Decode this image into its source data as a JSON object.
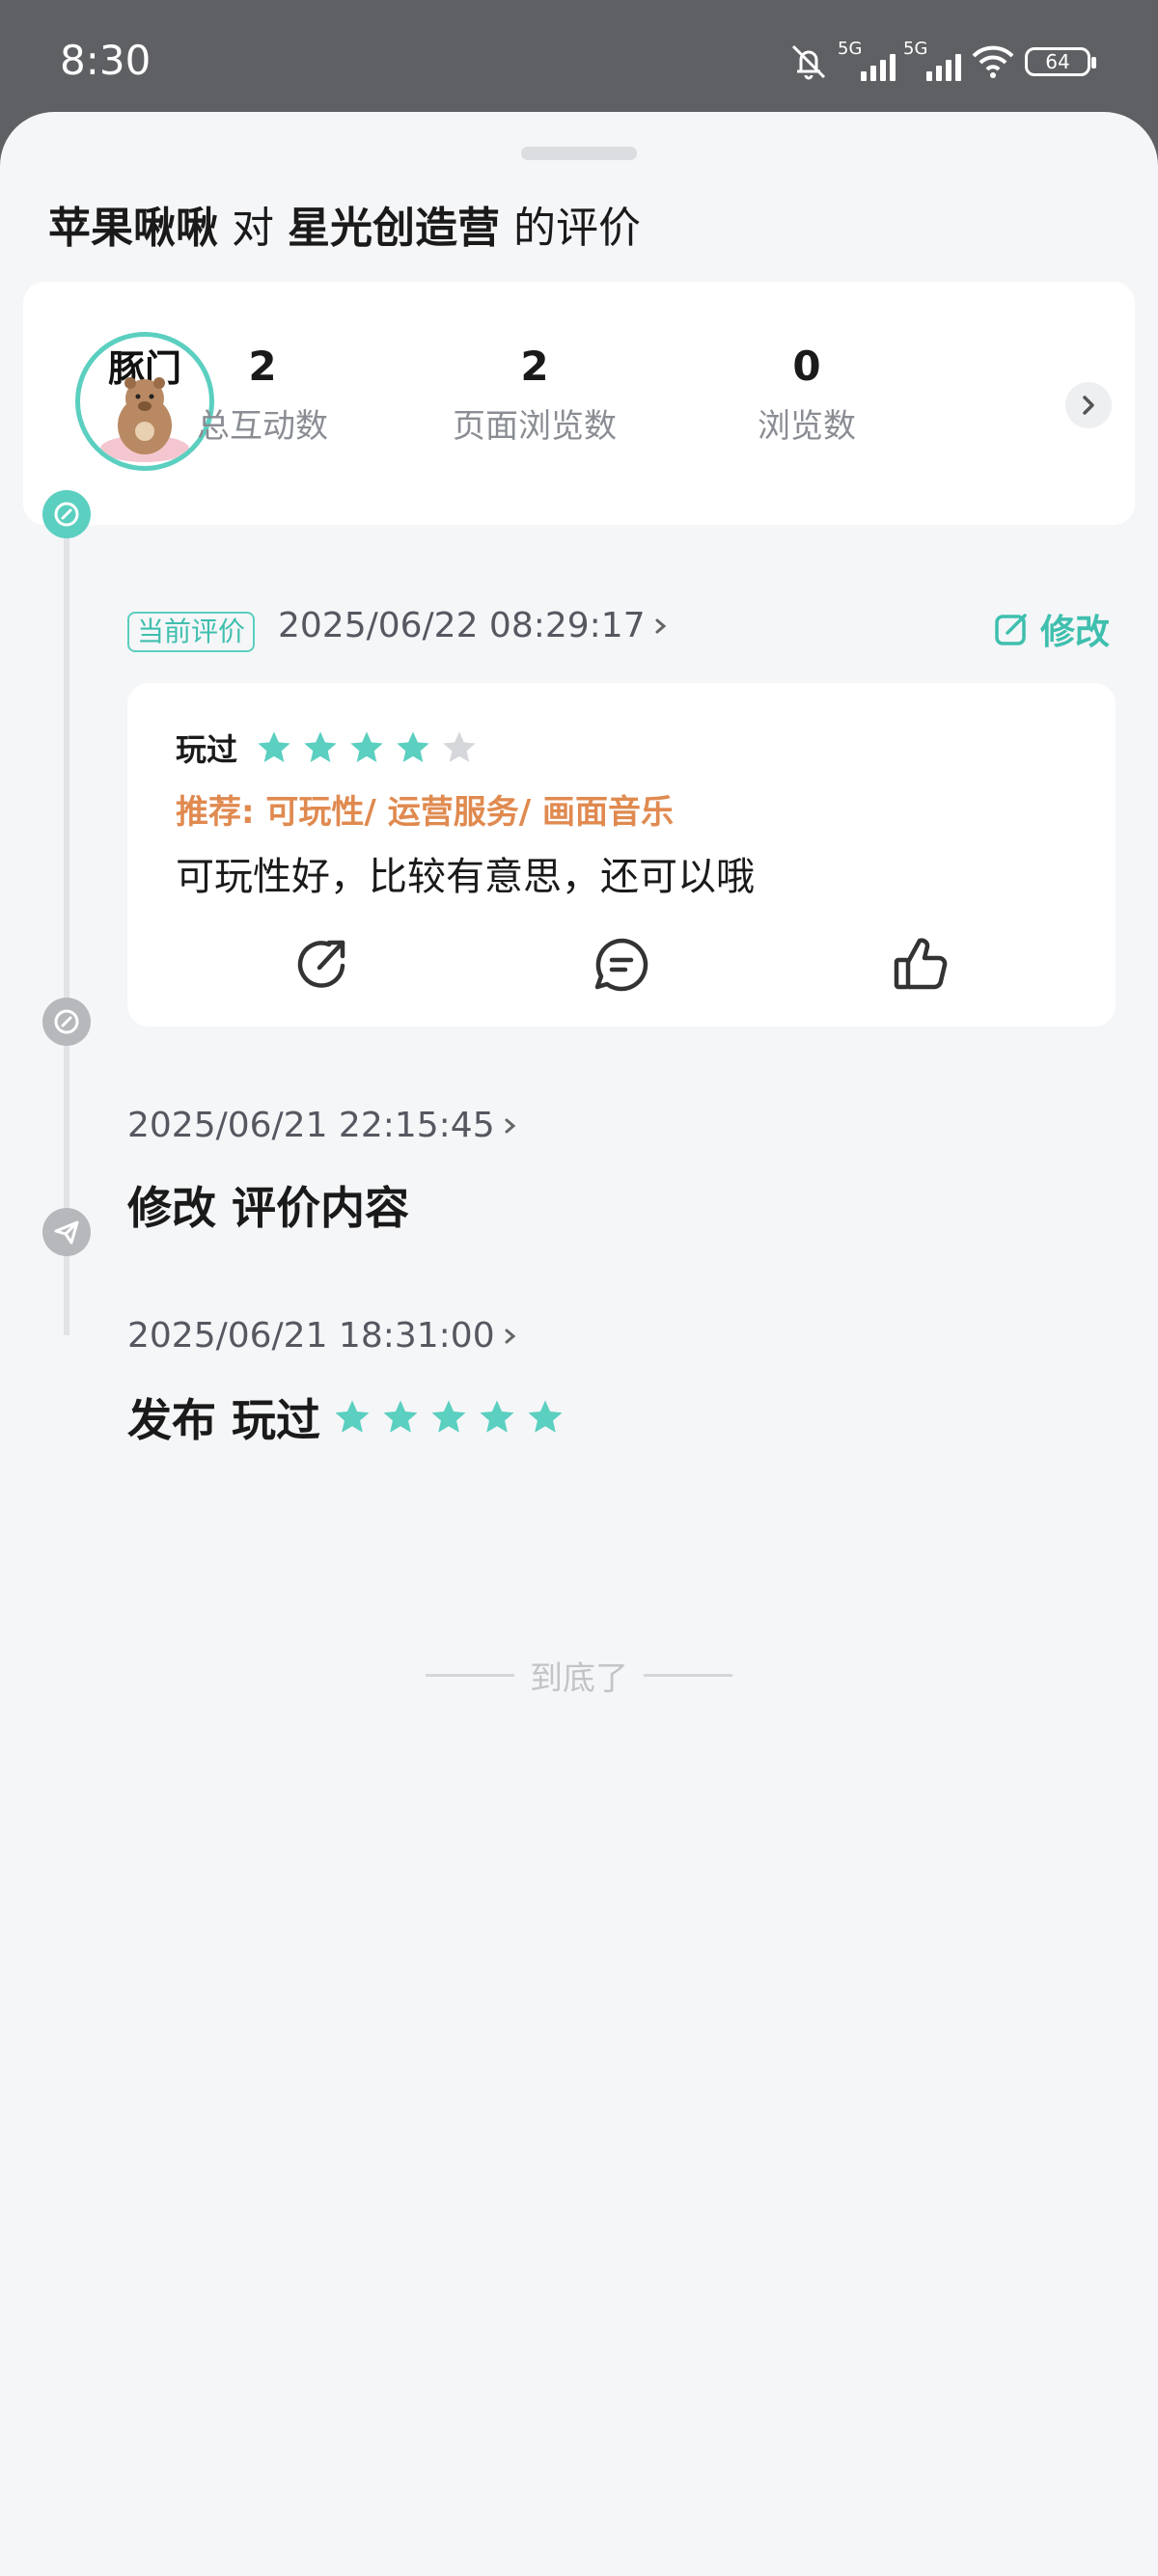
{
  "status_bar": {
    "time": "8:30",
    "net1": "5G",
    "net2": "5G",
    "battery": "64"
  },
  "header": {
    "user": "苹果啾啾",
    "connector": "对",
    "game": "星光创造营",
    "suffix": "的评价"
  },
  "avatar": {
    "text": "豚门"
  },
  "stats": [
    {
      "value": "2",
      "label": "总互动数"
    },
    {
      "value": "2",
      "label": "页面浏览数"
    },
    {
      "value": "0",
      "label": "浏览数"
    }
  ],
  "timeline": {
    "current": {
      "tag": "当前评价",
      "date": "2025/06/22 08:29:17",
      "edit_label": "修改",
      "played_label": "玩过",
      "rating": 4,
      "recommend": "推荐: 可玩性/ 运营服务/ 画面音乐",
      "content": "可玩性好，比较有意思，还可以哦"
    },
    "history": [
      {
        "date": "2025/06/21 22:15:45",
        "action": "修改 评价内容"
      },
      {
        "date": "2025/06/21 18:31:00",
        "action": "发布 玩过",
        "rating": 5
      }
    ]
  },
  "footer": {
    "end_text": "到底了"
  },
  "colors": {
    "accent": "#5bcfc0",
    "recommend": "#e08a50",
    "star_empty": "#d6d7db"
  },
  "icons": [
    "mute-icon",
    "signal-icon",
    "wifi-icon",
    "battery-icon",
    "edit-icon",
    "share-icon",
    "comment-icon",
    "like-icon",
    "send-icon",
    "chevron-right-icon"
  ]
}
